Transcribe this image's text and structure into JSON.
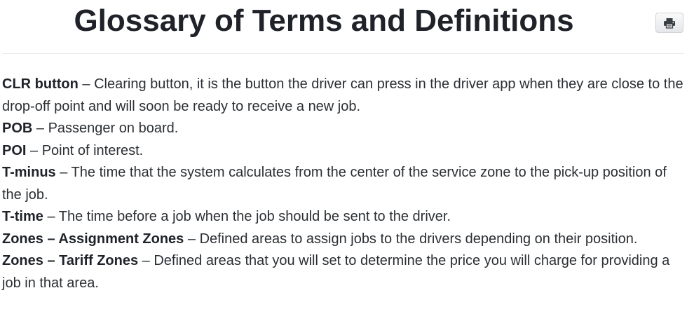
{
  "header": {
    "title": "Glossary of Terms and Definitions",
    "print_icon": "printer-icon"
  },
  "glossary": {
    "separator": " – ",
    "entries": [
      {
        "term": "CLR button",
        "definition": "Clearing button, it is the button the driver can press in the driver app when they are close to the drop-off point and will soon be ready to receive a new job."
      },
      {
        "term": "POB",
        "definition": "Passenger on board."
      },
      {
        "term": "POI",
        "definition": "Point of interest."
      },
      {
        "term": "T-minus",
        "definition": "The time that the system calculates from the center of the service zone to the pick-up position of the job."
      },
      {
        "term": "T-time",
        "definition": "The time before a job when the job should be sent to the driver."
      },
      {
        "term": "Zones – Assignment Zones",
        "definition": "Defined areas to assign jobs to the drivers depending on their position."
      },
      {
        "term": "Zones – Tariff Zones",
        "definition": "Defined areas that you will set to determine the price you will charge for providing a job in that area."
      }
    ]
  }
}
